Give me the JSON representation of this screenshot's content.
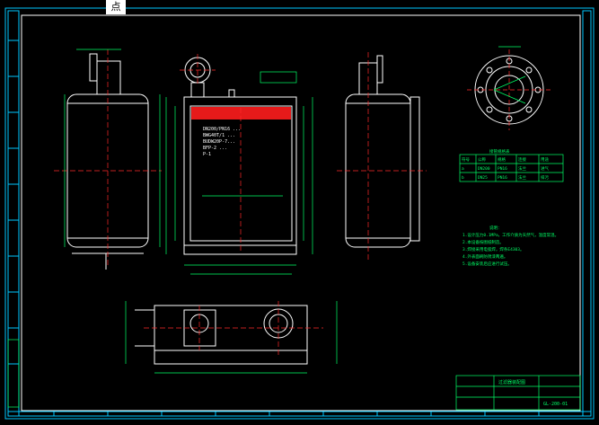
{
  "tooltip": {
    "label": "点"
  },
  "colors": {
    "background": "#000000",
    "frame_cyan": "#00c8ff",
    "drawing_white": "#ffffff",
    "dimension_green": "#00ff66",
    "centerline_red": "#ff2a2a",
    "fill_red": "#e61a1a"
  },
  "front_view": {
    "notes": [
      "DN200/PN16 ...",
      "BWG40T/1 ...",
      "BUDW20P-7...",
      "BFP-2 ...",
      "P-1"
    ]
  },
  "table": {
    "title": "接管规格表",
    "headers": [
      "符号",
      "公称",
      "规格",
      "连接",
      "用途"
    ],
    "rows": [
      [
        "a",
        "DN200",
        "PN16",
        "法兰",
        "进气"
      ],
      [
        "b",
        "DN25",
        "PN16",
        "法兰",
        "排污"
      ]
    ]
  },
  "notes_block": {
    "title": "说明：",
    "lines": [
      "1.设计压力0.1MPa，工作介质为天然气，温度常温。",
      "2.本设备按图纸制造。",
      "3.焊接采用电弧焊，焊条E4303。",
      "4.外表面刷防锈漆两遍。",
      "5.设备安装后应进行试压。"
    ]
  },
  "title_block": {
    "name": "过滤器装配图",
    "drawing_no": "GL-200-01"
  }
}
